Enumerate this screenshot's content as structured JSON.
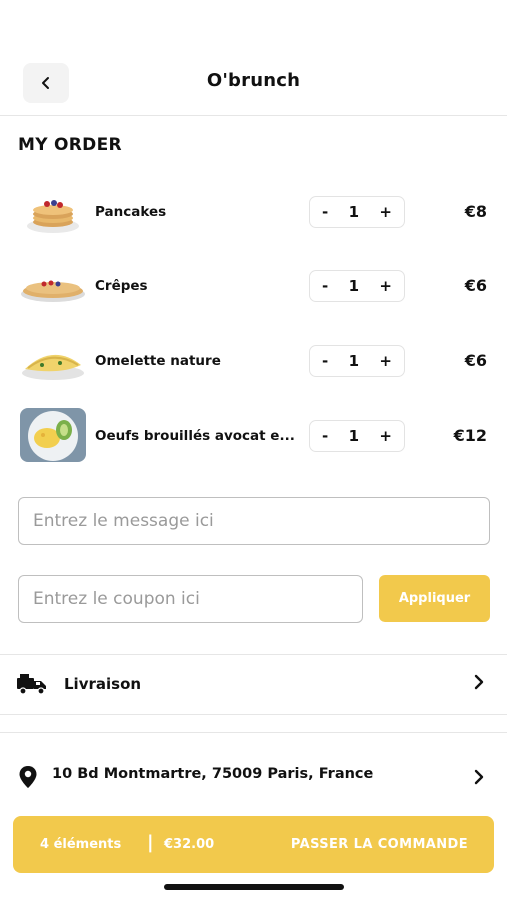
{
  "header": {
    "title": "O'brunch",
    "back_icon": "arrow-left-icon"
  },
  "order": {
    "section_title": "MY ORDER",
    "items": [
      {
        "name": "Pancakes",
        "qty": "1",
        "price": "€8",
        "minus": "-",
        "plus": "+"
      },
      {
        "name": "Crêpes",
        "qty": "1",
        "price": "€6",
        "minus": "-",
        "plus": "+"
      },
      {
        "name": "Omelette nature",
        "qty": "1",
        "price": "€6",
        "minus": "-",
        "plus": "+"
      },
      {
        "name": "Oeufs brouillés avocat e...",
        "qty": "1",
        "price": "€12",
        "minus": "-",
        "plus": "+"
      }
    ]
  },
  "message": {
    "placeholder": "Entrez le message ici"
  },
  "coupon": {
    "placeholder": "Entrez le coupon ici",
    "apply_label": "Appliquer"
  },
  "delivery": {
    "label": "Livraison",
    "icon": "delivery-truck-icon"
  },
  "address": {
    "label": "10 Bd Montmartre, 75009 Paris, France",
    "icon": "location-pin-icon"
  },
  "footer": {
    "count": "4 éléments",
    "separator": "|",
    "total": "€32.00",
    "cta": "PASSER LA COMMANDE"
  },
  "colors": {
    "accent": "#F2C94C",
    "text": "#111111",
    "placeholder": "#9A9A9A"
  }
}
